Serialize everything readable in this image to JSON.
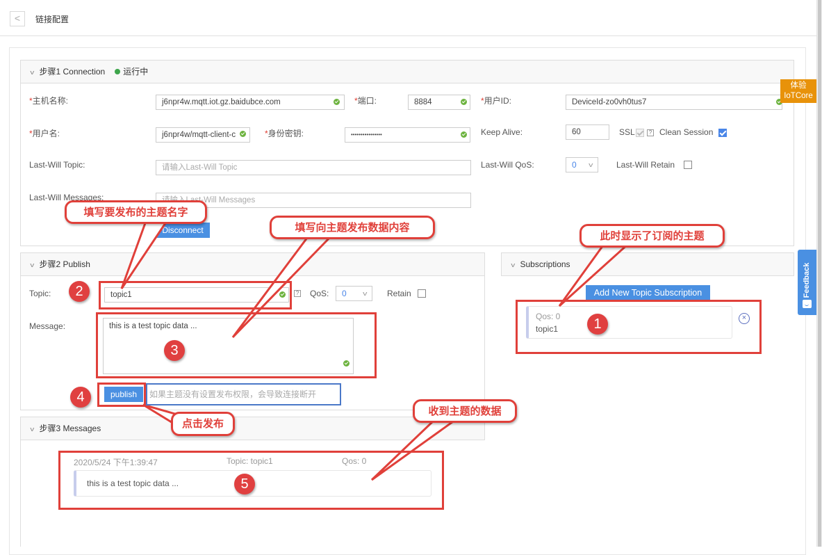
{
  "header": {
    "back_icon": "chevron-left-icon",
    "back_glyph": "<",
    "title": "链接配置"
  },
  "step1": {
    "title": "步骤1   Connection",
    "status": "运行中",
    "status_color": "#3ea54c",
    "host_label": "主机名称:",
    "host_value": "j6npr4w.mqtt.iot.gz.baidubce.com",
    "port_label": "端口:",
    "port_value": "8884",
    "userid_label": "用户ID:",
    "userid_value": "DeviceId-zo0vh0tus7",
    "username_label": "用户名:",
    "username_value": "j6npr4w/mqtt-client-c",
    "secret_label": "身份密钥:",
    "secret_value": "••••••••••••••••",
    "keepalive_label": "Keep Alive:",
    "keepalive_value": "60",
    "ssl_label": "SSL",
    "ssl_checked": true,
    "help_glyph": "?",
    "clean_session_label": "Clean Session",
    "clean_session_checked": true,
    "lw_topic_label": "Last-Will Topic:",
    "lw_topic_placeholder": "请输入Last-Will Topic",
    "lw_qos_label": "Last-Will QoS:",
    "lw_qos_value": "0",
    "lw_retain_label": "Last-Will Retain",
    "lw_retain_checked": false,
    "lw_messages_label": "Last-Will Messages:",
    "lw_messages_placeholder": "请输入Last-Will Messages",
    "disconnect_label": "Disconnect",
    "required_mark": "*"
  },
  "step2": {
    "title": "步骤2   Publish",
    "topic_label": "Topic:",
    "topic_value": "topic1",
    "qos_label": "QoS:",
    "qos_value": "0",
    "retain_label": "Retain",
    "retain_checked": false,
    "message_label": "Message:",
    "message_value": "this is a test topic data ...",
    "publish_label": "publish",
    "publish_hint": "如果主题没有设置发布权限，会导致连接断开"
  },
  "subscriptions": {
    "title": "Subscriptions",
    "add_label": "Add New Topic Subscription",
    "items": [
      {
        "qos": "Qos: 0",
        "topic": "topic1"
      }
    ],
    "remove_glyph": "×"
  },
  "step3": {
    "title": "步骤3   Messages",
    "messages": [
      {
        "time": "2020/5/24 下午1:39:47",
        "topic": "Topic: topic1",
        "qos": "Qos: 0",
        "payload": "this is a test topic data ..."
      }
    ]
  },
  "side": {
    "iot_line1": "体验",
    "iot_line2": "IoTCore",
    "feedback_label": "Feedback"
  },
  "annotations": {
    "callouts": {
      "topic_name": "填写要发布的主题名字",
      "message_content": "填写向主题发布数据内容",
      "subscribed_topic": "此时显示了订阅的主题",
      "click_publish": "点击发布",
      "received_data": "收到主题的数据"
    },
    "badges": [
      "1",
      "2",
      "3",
      "4",
      "5"
    ],
    "color_red": "#e0403a",
    "color_blue": "#4a78c8"
  }
}
